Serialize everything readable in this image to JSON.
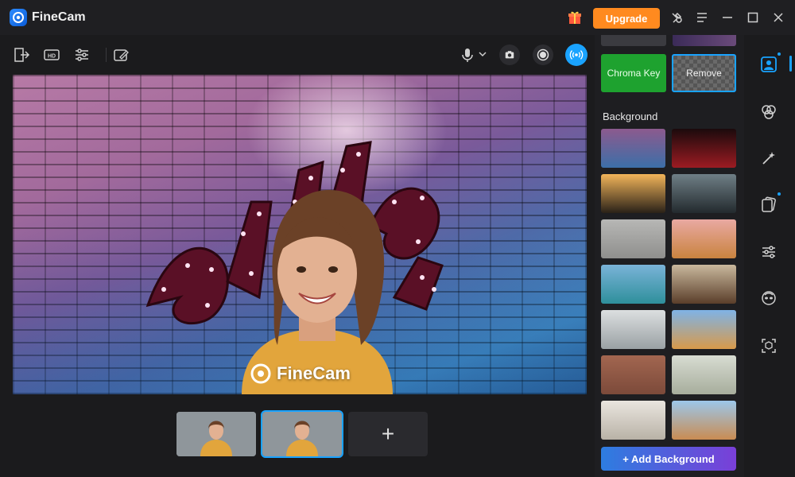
{
  "app": {
    "title": "FineCam"
  },
  "titlebar": {
    "upgrade_label": "Upgrade"
  },
  "preview": {
    "watermark_text": "FineCam"
  },
  "thumbnails": {
    "add_label": "+"
  },
  "panel": {
    "chroma_key_label": "Chroma Key",
    "remove_label": "Remove",
    "background_heading": "Background",
    "add_background_label": "+ Add Background",
    "backgrounds": [
      {
        "name": "neon-brick-wall",
        "colors": [
          "#8c5a8e",
          "#3c6fa8"
        ]
      },
      {
        "name": "cinema-seats",
        "colors": [
          "#1b0a0c",
          "#9c1b22"
        ]
      },
      {
        "name": "sunset-field",
        "colors": [
          "#f2b45a",
          "#2a2118"
        ]
      },
      {
        "name": "modern-office-window",
        "colors": [
          "#6f7f86",
          "#232a2e"
        ]
      },
      {
        "name": "grey-concrete",
        "colors": [
          "#b7b7b5",
          "#8f8f8d"
        ]
      },
      {
        "name": "eiffel-tower-sky",
        "colors": [
          "#e9a9a2",
          "#c9833f"
        ]
      },
      {
        "name": "mountain-lake",
        "colors": [
          "#7ab3d8",
          "#2e8f9b"
        ]
      },
      {
        "name": "library-interior",
        "colors": [
          "#c9b89d",
          "#5a3e2a"
        ]
      },
      {
        "name": "bright-office",
        "colors": [
          "#dcdfe0",
          "#9aa1a4"
        ]
      },
      {
        "name": "desert-dunes",
        "colors": [
          "#7fb3e6",
          "#d89a4a"
        ]
      },
      {
        "name": "red-brick-wall",
        "colors": [
          "#a26650",
          "#7c4a3a"
        ]
      },
      {
        "name": "plant-corner",
        "colors": [
          "#d8dcd2",
          "#a7ad9c"
        ]
      },
      {
        "name": "gallery-wall",
        "colors": [
          "#e9e5df",
          "#b9b2a6"
        ]
      },
      {
        "name": "rocky-desert",
        "colors": [
          "#9cc7ea",
          "#c98c52"
        ]
      }
    ]
  },
  "colors": {
    "accent": "#19a3ff",
    "upgrade": "#ff8a1f",
    "chroma": "#1ea22f"
  }
}
